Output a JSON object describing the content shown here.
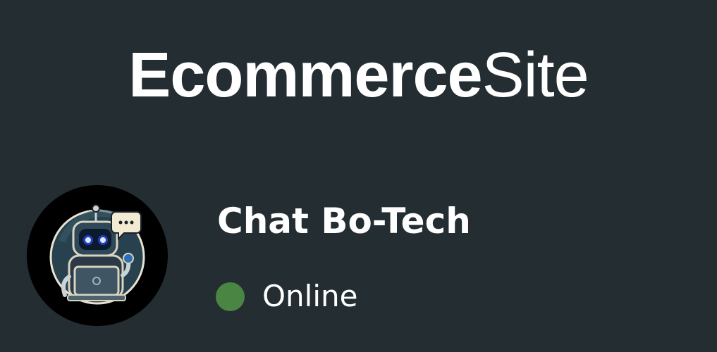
{
  "brand": {
    "part_bold": "Ecommerce",
    "part_light": "Site"
  },
  "chat": {
    "bot_name": "Chat Bo-Tech",
    "status": "Online",
    "status_color": "#4a8543",
    "avatar_icon": "robot-avatar-icon"
  },
  "colors": {
    "background": "#232d32",
    "text": "#ffffff",
    "avatar_bg": "#000000"
  }
}
